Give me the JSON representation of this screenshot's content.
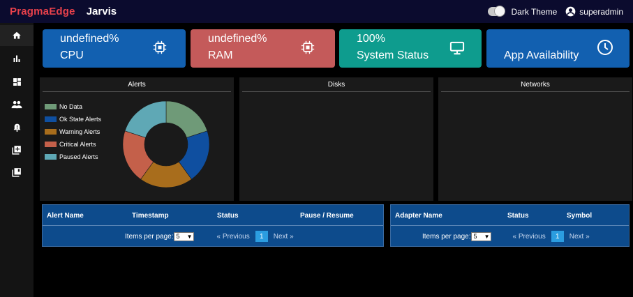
{
  "header": {
    "brand": "PragmaEdge",
    "app_name": "Jarvis",
    "theme_label": "Dark Theme",
    "user": "superadmin"
  },
  "sidebar": {
    "items": [
      {
        "icon": "home-icon"
      },
      {
        "icon": "bar-chart-icon"
      },
      {
        "icon": "dashboard-icon"
      },
      {
        "icon": "people-icon"
      },
      {
        "icon": "alert-bell-icon"
      },
      {
        "icon": "add-box-icon"
      },
      {
        "icon": "library-icon"
      }
    ]
  },
  "cards": [
    {
      "title": "undefined%",
      "subtitle": "CPU",
      "icon": "chip-icon",
      "color": "#1260b0"
    },
    {
      "title": "undefined%",
      "subtitle": "RAM",
      "icon": "chip-icon",
      "color": "#c45a5a"
    },
    {
      "title": "100%",
      "subtitle": "System Status",
      "icon": "monitor-icon",
      "color": "#0e9c8e"
    },
    {
      "title": "",
      "subtitle": "App Availability",
      "icon": "clock-icon",
      "color": "#1260b0"
    }
  ],
  "panels": {
    "alerts": "Alerts",
    "disks": "Disks",
    "networks": "Networks"
  },
  "legend": [
    {
      "label": "No Data",
      "color": "#6f9a78"
    },
    {
      "label": "Ok State Alerts",
      "color": "#0f4fa0"
    },
    {
      "label": "Warning Alerts",
      "color": "#a86d1c"
    },
    {
      "label": "Critical Alerts",
      "color": "#c4604a"
    },
    {
      "label": "Paused Alerts",
      "color": "#5fa8b5"
    }
  ],
  "donut_slices": [
    {
      "label": "No Data",
      "value": 20
    },
    {
      "label": "Ok State Alerts",
      "value": 20
    },
    {
      "label": "Warning Alerts",
      "value": 20
    },
    {
      "label": "Critical Alerts",
      "value": 20
    },
    {
      "label": "Paused Alerts",
      "value": 20
    }
  ],
  "alerts_table": {
    "columns": [
      "Alert Name",
      "Timestamp",
      "Status",
      "Pause / Resume"
    ],
    "items_per_page_label": "Items per page:",
    "items_per_page": "5",
    "prev": "« Previous",
    "page": "1",
    "next": "Next »"
  },
  "adapter_table": {
    "columns": [
      "Adapter Name",
      "Status",
      "Symbol"
    ],
    "items_per_page_label": "Items per page:",
    "items_per_page": "5",
    "prev": "« Previous",
    "page": "1",
    "next": "Next »"
  }
}
